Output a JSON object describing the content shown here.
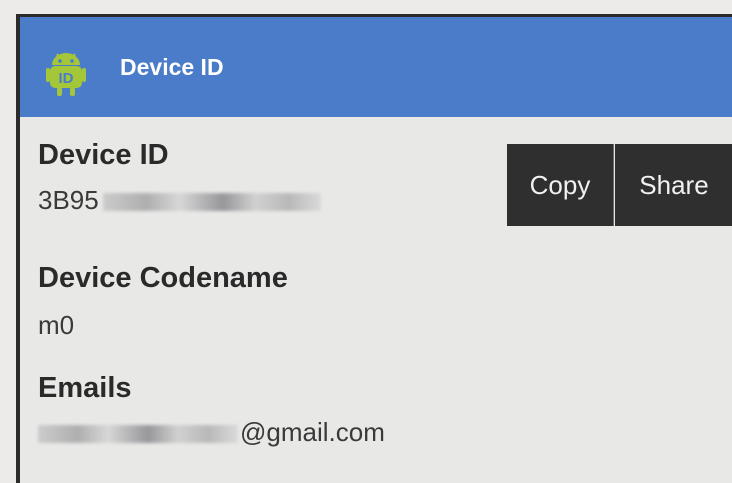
{
  "app": {
    "title": "Device ID",
    "icon": "android-robot-icon",
    "accent_color": "#4a7cc9"
  },
  "buttons": {
    "copy_label": "Copy",
    "share_label": "Share"
  },
  "fields": {
    "device_id": {
      "label": "Device ID",
      "value_prefix": "3B95"
    },
    "codename": {
      "label": "Device Codename",
      "value": "m0"
    },
    "emails": {
      "label": "Emails",
      "value_suffix": "@gmail.com"
    }
  }
}
